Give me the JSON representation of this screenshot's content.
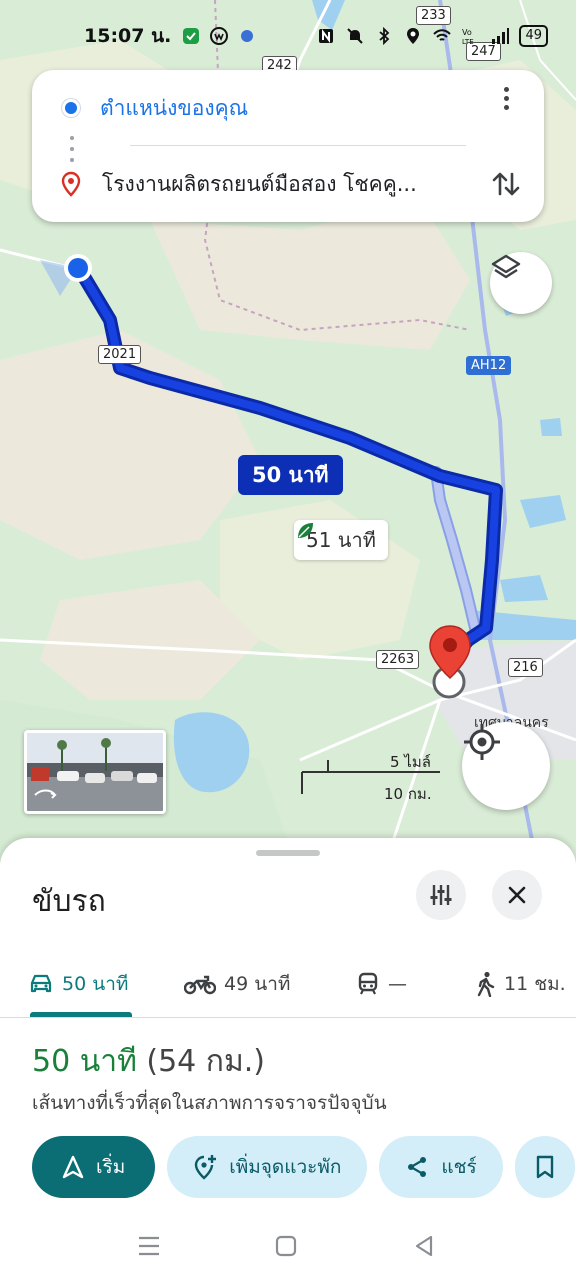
{
  "status_bar": {
    "time": "15:07 น.",
    "battery": "49"
  },
  "route_card": {
    "origin": "ตำแหน่งของคุณ",
    "destination": "โรงงานผลิตรถยนต์มือสอง โชคคู..."
  },
  "map": {
    "primary_route_label": "50 นาที",
    "alt_route_label": "51 นาที",
    "shields": [
      "233",
      "247",
      "242",
      "2021",
      "AH12",
      "2263",
      "216"
    ],
    "place_label": "เทศบาลนคร",
    "scale_miles": "5 ไมล์",
    "scale_km": "10 กม."
  },
  "sheet": {
    "title": "ขับรถ",
    "tabs": [
      {
        "label": "50 นาที",
        "icon": "car-icon"
      },
      {
        "label": "49 นาที",
        "icon": "motorcycle-icon"
      },
      {
        "label": "—",
        "icon": "train-icon"
      },
      {
        "label": "11 ชม.",
        "icon": "walk-icon"
      }
    ],
    "summary_duration": "50 นาที",
    "summary_distance": "(54 กม.)",
    "subtitle": "เส้นทางที่เร็วที่สุดในสภาพการจราจรปัจจุบัน",
    "actions": {
      "start": "เริ่ม",
      "add_stop": "เพิ่มจุดแวะพัก",
      "share": "แชร์"
    }
  },
  "colors": {
    "route_primary": "#0d2fb5",
    "route_alt": "#a9b9ec",
    "accent_teal": "#0b6e75",
    "duration_green": "#188038",
    "origin_blue": "#1a73e8",
    "pin_red": "#d93025"
  }
}
